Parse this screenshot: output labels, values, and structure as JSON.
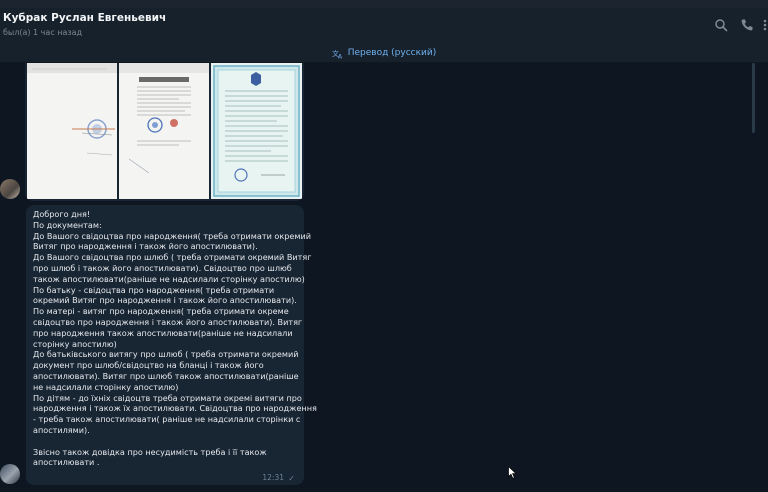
{
  "header": {
    "name": "Кубрак Руслан Евгеньевич",
    "status": "был(а) 1 час назад",
    "icons": [
      "search-icon",
      "phone-icon",
      "more-icon"
    ]
  },
  "translate": {
    "label": "Перевод (русский)",
    "icon": "translate-icon"
  },
  "message": {
    "lines": [
      "Доброго дня!",
      "По документам:",
      "До Вашого свідоцтва про народження( треба отримати окремий",
      "Витяг про народження і також його апостилювати).",
      "До Вашого свідоцтва про шлюб ( треба отримати окремий Витяг",
      "про шлюб і також його апостилювати).  Свідоцтво про шлюб",
      "також апостилювати(раніше не надсилали сторінку апостилю)",
      "По батьку -   свідоцтва про народження( треба отримати",
      "окремий Витяг про народження і також його апостилювати).",
      "По матері - витяг про народження( треба отримати окреме",
      "свідоцтво  про народження і також його апостилювати). Витяг",
      "про народження також апостилювати(раніше не надсилали",
      "сторінку апостилю)",
      "До батьківського витягу  про шлюб ( треба отримати окремий",
      "документ про шлюб/свідоцтво на бланці  і також його",
      "апостилювати).  Витяг про шлюб також апостилювати(раніше",
      "не надсилали сторінку апостилю)",
      "По дітям - до їхніх свідоцтв треба отримати окремі витяги про",
      "народження і також їх апостилювати. Свідоцтва про народження",
      "- треба також апостилювати( раніше не надсилали сторінки с",
      "апостилями).",
      "",
      "Звісно також довідка про несудимість  треба  і її також",
      "апостилювати ."
    ],
    "time": "12:31"
  }
}
